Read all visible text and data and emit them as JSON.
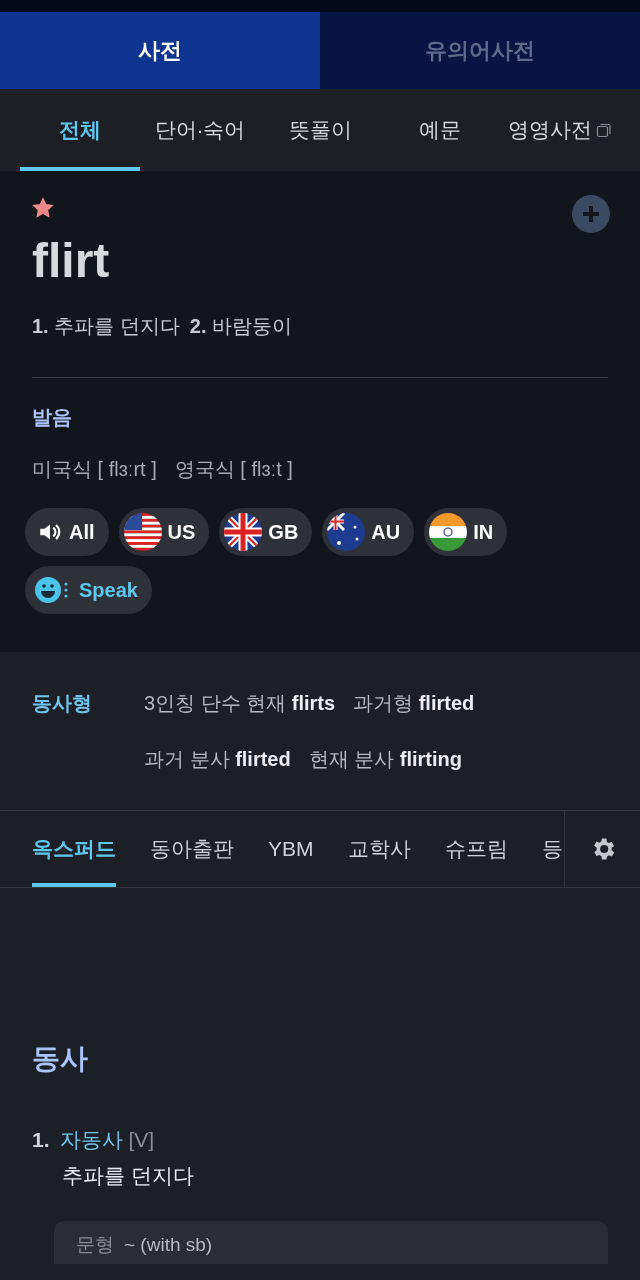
{
  "top_tabs": [
    {
      "label": "사전",
      "selected": true
    },
    {
      "label": "유의어사전",
      "selected": false
    }
  ],
  "sub_tabs": [
    {
      "label": "전체",
      "selected": true,
      "external": false
    },
    {
      "label": "단어·숙어",
      "selected": false,
      "external": false
    },
    {
      "label": "뜻풀이",
      "selected": false,
      "external": false
    },
    {
      "label": "예문",
      "selected": false,
      "external": false
    },
    {
      "label": "영영사전",
      "selected": false,
      "external": true
    }
  ],
  "entry": {
    "starred": true,
    "word": "flirt",
    "meanings": [
      "**1.** 추파를 던지다",
      "**2.** 바람둥이"
    ]
  },
  "pronunciation": {
    "title": "발음",
    "variants": [
      "미국식 [ flɜːrt ]",
      "영국식 [ flɜːt ]"
    ],
    "buttons": [
      {
        "kind": "all",
        "label": "All"
      },
      {
        "kind": "us",
        "label": "US"
      },
      {
        "kind": "gb",
        "label": "GB"
      },
      {
        "kind": "au",
        "label": "AU"
      },
      {
        "kind": "in",
        "label": "IN"
      },
      {
        "kind": "speak",
        "label": "Speak"
      }
    ]
  },
  "verb_forms": {
    "title": "동사형",
    "rows": [
      [
        "3인칭 단수 현재 **flirts**",
        "과거형 **flirted**"
      ],
      [
        "과거 분사 **flirted**",
        "현재 분사 **flirting**"
      ]
    ]
  },
  "dict_tabs": [
    {
      "label": "옥스퍼드",
      "selected": true
    },
    {
      "label": "동아출판",
      "selected": false
    },
    {
      "label": "YBM",
      "selected": false
    },
    {
      "label": "교학사",
      "selected": false
    },
    {
      "label": "슈프림",
      "selected": false
    },
    {
      "label": "등",
      "selected": false
    }
  ],
  "definition": {
    "pos": "동사",
    "senses": [
      {
        "number": "1.",
        "type": "자동사",
        "code": "[V]",
        "meaning": "추파를 던지다",
        "pattern_label": "문형",
        "pattern": "~ (with sb)"
      }
    ]
  }
}
